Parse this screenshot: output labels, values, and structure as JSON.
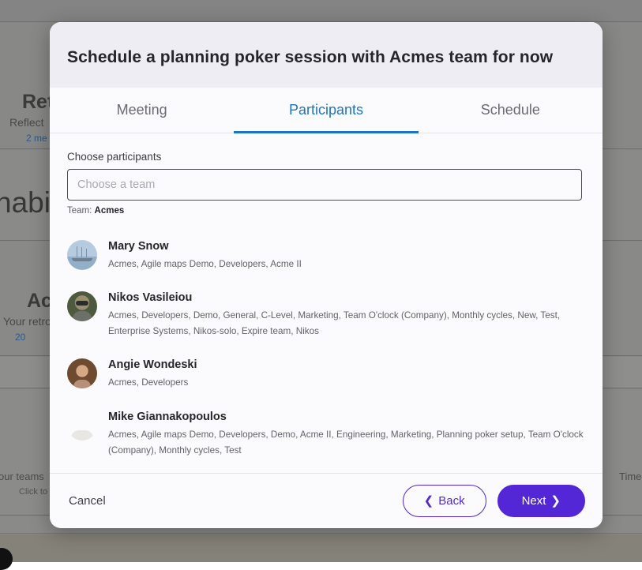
{
  "background": {
    "card1_title": "Ret",
    "card1_sub": "Reflect ",
    "card1_link": "2 me",
    "card2_text": "habit",
    "card3_title": "Ac",
    "card3_sub": "Your retro",
    "card3_link": "20 ",
    "card5_text": "our teams",
    "card5_sub": "Click to vie",
    "footer_right_text": "Time"
  },
  "modal": {
    "title": "Schedule a planning poker session with Acmes team for now",
    "tabs": [
      {
        "label": "Meeting",
        "active": false
      },
      {
        "label": "Participants",
        "active": true
      },
      {
        "label": "Schedule",
        "active": false
      }
    ],
    "form": {
      "label": "Choose participants",
      "input_value": "",
      "input_placeholder": "Choose a team",
      "team_note_prefix": "Team: ",
      "team_note_value": "Acmes"
    },
    "participants": [
      {
        "name": "Mary Snow",
        "teams": "Acmes, Agile maps Demo, Developers, Acme II",
        "avatar": "a-boat"
      },
      {
        "name": "Nikos Vasileiou",
        "teams": "Acmes, Developers, Demo, General, C-Level, Marketing, Team O'clock (Company), Monthly cycles, New, Test, Enterprise Systems, Nikos-solo, Expire team, Nikos",
        "avatar": "a-nikos"
      },
      {
        "name": "Angie Wondeski",
        "teams": "Acmes, Developers",
        "avatar": "a-angie"
      },
      {
        "name": "Mike Giannakopoulos",
        "teams": "Acmes, Agile maps Demo, Developers, Demo, Acme II, Engineering, Marketing, Planning poker setup, Team O'clock (Company), Monthly cycles, Test",
        "avatar": "a-mike"
      }
    ],
    "footer": {
      "cancel_label": "Cancel",
      "back_label": "Back",
      "back_icon": "chevron-left-icon",
      "next_label": "Next",
      "next_icon": "chevron-right-icon"
    }
  },
  "colors": {
    "accent_purple": "#5327d6",
    "active_tab_blue": "#1d74c0",
    "header_bg": "#efedf4",
    "modal_bg": "#fbfafc",
    "overlay": "#878785"
  }
}
